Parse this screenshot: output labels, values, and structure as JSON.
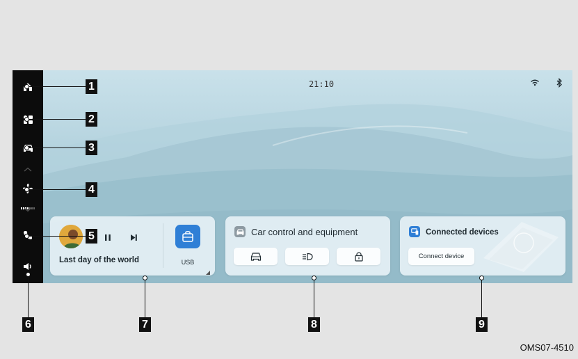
{
  "status_bar": {
    "time": "21:10",
    "wifi_icon": "wifi-icon",
    "bluetooth_icon": "bluetooth-icon"
  },
  "sidebar": {
    "items": [
      {
        "name": "home",
        "icon": "home-icon"
      },
      {
        "name": "apps",
        "icon": "apps-grid-icon"
      },
      {
        "name": "car",
        "icon": "car-icon"
      },
      {
        "name": "climate",
        "icon": "fan-icon"
      },
      {
        "name": "phone",
        "icon": "phone-icon"
      },
      {
        "name": "volume",
        "icon": "volume-icon"
      }
    ]
  },
  "media_card": {
    "song_title": "Last day of the world",
    "source_label": "USB",
    "state": "playing"
  },
  "car_control_card": {
    "title": "Car control and equipment",
    "buttons": [
      {
        "icon": "car-icon"
      },
      {
        "icon": "headlight-icon"
      },
      {
        "icon": "lock-icon"
      }
    ]
  },
  "connected_card": {
    "title": "Connected devices",
    "button_label": "Connect device"
  },
  "callouts": [
    "1",
    "2",
    "3",
    "4",
    "5",
    "6",
    "7",
    "8",
    "9"
  ],
  "figure_code": "OMS07-4510",
  "colors": {
    "sidebar_bg": "#0c0c0c",
    "accent_blue": "#2f7fd6",
    "callout_bg": "#111111",
    "card_bg": "#e9f3f7"
  }
}
